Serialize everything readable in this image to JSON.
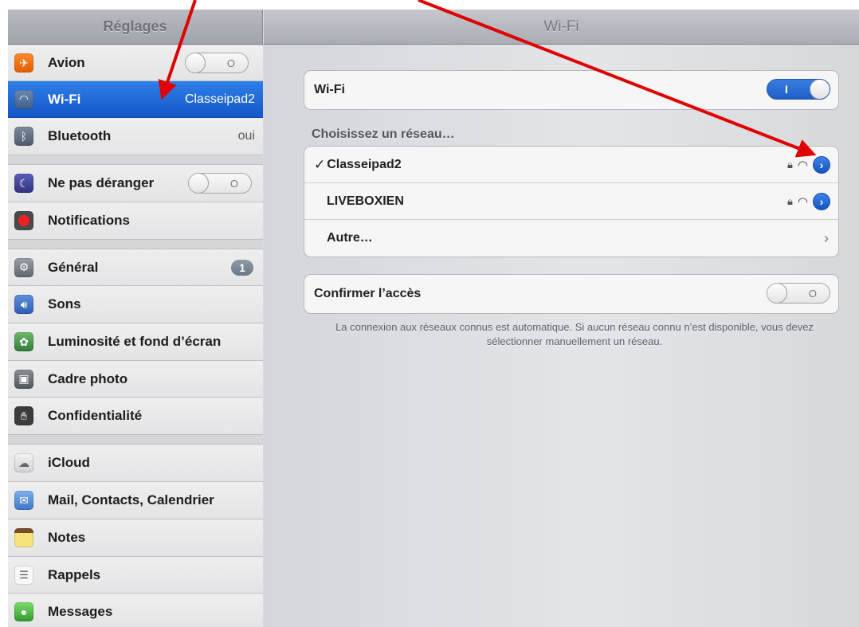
{
  "sidebar": {
    "title": "Réglages",
    "items": [
      {
        "label": "Avion",
        "icon": "airplane-icon",
        "toggle": "O"
      },
      {
        "label": "Wi-Fi",
        "icon": "wifi-icon",
        "value": "Classeipad2",
        "selected": true
      },
      {
        "label": "Bluetooth",
        "icon": "bluetooth-icon",
        "value": "oui"
      },
      {
        "label": "Ne pas déranger",
        "icon": "moon-icon",
        "toggle": "O"
      },
      {
        "label": "Notifications",
        "icon": "notifications-icon"
      },
      {
        "label": "Général",
        "icon": "gear-icon",
        "badge": "1"
      },
      {
        "label": "Sons",
        "icon": "speaker-icon"
      },
      {
        "label": "Luminosité et fond d’écran",
        "icon": "flower-icon"
      },
      {
        "label": "Cadre photo",
        "icon": "photo-frame-icon"
      },
      {
        "label": "Confidentialité",
        "icon": "hand-icon"
      },
      {
        "label": "iCloud",
        "icon": "cloud-icon"
      },
      {
        "label": "Mail, Contacts, Calendrier",
        "icon": "mail-icon"
      },
      {
        "label": "Notes",
        "icon": "notes-icon"
      },
      {
        "label": "Rappels",
        "icon": "reminders-icon"
      },
      {
        "label": "Messages",
        "icon": "messages-icon"
      }
    ]
  },
  "detail": {
    "title": "Wi-Fi",
    "wifi_row": {
      "label": "Wi-Fi",
      "toggle": "I"
    },
    "networks_header": "Choisissez un réseau…",
    "networks": [
      {
        "name": "Classeipad2",
        "connected": true,
        "check": "✓"
      },
      {
        "name": "LIVEBOXIEN",
        "connected": false
      }
    ],
    "other_label": "Autre…",
    "ask_row": {
      "label": "Confirmer l’accès",
      "toggle": "O"
    },
    "footer": "La connexion aux réseaux connus est automatique. Si aucun réseau connu n’est disponible, vous devez sélectionner manuellement un réseau."
  },
  "colors": {
    "selected": "#1a63d6",
    "annotation_arrow": "#e00000",
    "disclosure": "#2467d0"
  }
}
